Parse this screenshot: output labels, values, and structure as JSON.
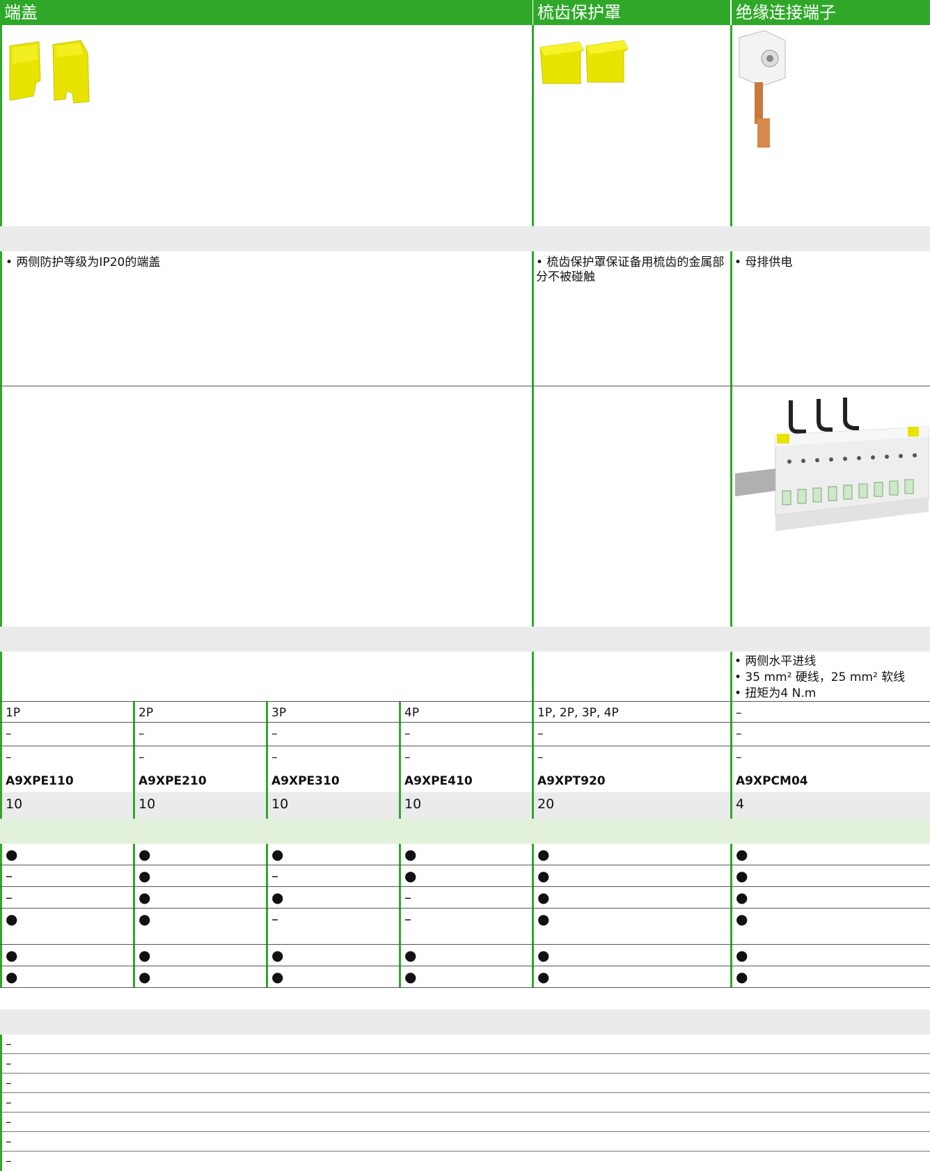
{
  "headers": {
    "end_cover": "端盖",
    "comb_cover": "梳齿保护罩",
    "terminal": "绝缘连接端子"
  },
  "descriptions": {
    "end_cover": "• 两侧防护等级为IP20的端盖",
    "comb_cover": "• 梳齿保护罩保证备用梳齿的金属部分不被碰触",
    "terminal": "• 母排供电"
  },
  "terminal_notes": [
    "• 两侧水平进线",
    "• 35 mm² 硬线，25 mm² 软线",
    "• 扭矩为4 N.m"
  ],
  "columns": [
    {
      "poles": "1P",
      "row2": "–",
      "row3": "–",
      "ref": "A9XPE110",
      "qty": "10",
      "compat": [
        "●",
        "–",
        "–",
        "●",
        "●",
        "●"
      ]
    },
    {
      "poles": "2P",
      "row2": "–",
      "row3": "–",
      "ref": "A9XPE210",
      "qty": "10",
      "compat": [
        "●",
        "●",
        "●",
        "●",
        "●",
        "●"
      ]
    },
    {
      "poles": "3P",
      "row2": "–",
      "row3": "–",
      "ref": "A9XPE310",
      "qty": "10",
      "compat": [
        "●",
        "–",
        "●",
        "–",
        "●",
        "●"
      ]
    },
    {
      "poles": "4P",
      "row2": "–",
      "row3": "–",
      "ref": "A9XPE410",
      "qty": "10",
      "compat": [
        "●",
        "●",
        "–",
        "–",
        "●",
        "●"
      ]
    },
    {
      "poles": "1P, 2P, 3P, 4P",
      "row2": "–",
      "row3": "–",
      "ref": "A9XPT920",
      "qty": "20",
      "compat": [
        "●",
        "●",
        "●",
        "●",
        "●",
        "●"
      ]
    },
    {
      "poles": "–",
      "row2": "–",
      "row3": "–",
      "ref": "A9XPCM04",
      "qty": "4",
      "compat": [
        "●",
        "●",
        "●",
        "●",
        "●",
        "●"
      ]
    }
  ],
  "bottom_rows": [
    "–",
    "–",
    "–",
    "–",
    "–",
    "–",
    "–"
  ],
  "colors": {
    "accent": "#2fa829",
    "band": "#ebebeb",
    "band_green": "#e2f1da",
    "yellow": "#e8e400"
  }
}
